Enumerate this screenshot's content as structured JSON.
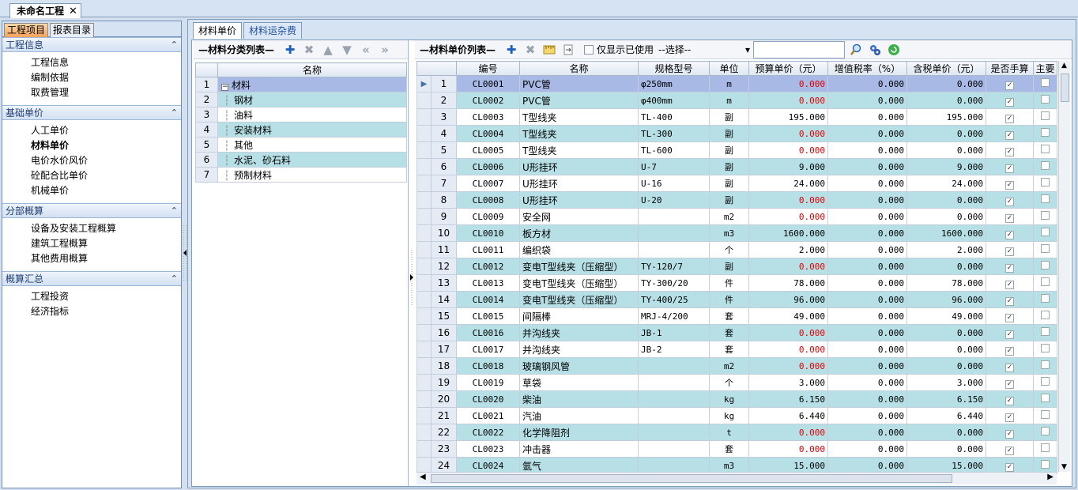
{
  "doc_tab": {
    "title": "未命名工程",
    "close": "✕"
  },
  "left_tabs": [
    {
      "label": "工程项目"
    },
    {
      "label": "报表目录"
    }
  ],
  "sections": [
    {
      "title": "工程信息",
      "items": [
        "工程信息",
        "编制依据",
        "取费管理"
      ]
    },
    {
      "title": "基础单价",
      "items": [
        "人工单价",
        "材料单价",
        "电价水价风价",
        "砼配合比单价",
        "机械单价"
      ]
    },
    {
      "title": "分部概算",
      "items": [
        "设备及安装工程概算",
        "建筑工程概算",
        "其他费用概算"
      ]
    },
    {
      "title": "概算汇总",
      "items": [
        "工程投资",
        "经济指标"
      ]
    }
  ],
  "active_nav": "材料单价",
  "main_tabs": [
    {
      "label": "材料单价"
    },
    {
      "label": "材料运杂费"
    }
  ],
  "category_pane": {
    "title": "—材料分类列表—",
    "column": "名称",
    "rows": [
      {
        "n": "1",
        "name": "材料"
      },
      {
        "n": "2",
        "name": "钢材"
      },
      {
        "n": "3",
        "name": "油料"
      },
      {
        "n": "4",
        "name": "安装材料"
      },
      {
        "n": "5",
        "name": "其他"
      },
      {
        "n": "6",
        "name": "水泥、砂石料"
      },
      {
        "n": "7",
        "name": "预制材料"
      }
    ]
  },
  "price_pane": {
    "title": "—材料单价列表—",
    "only_used_label": "仅显示已使用",
    "select_value": "--选择--",
    "columns": [
      "",
      "编号",
      "名称",
      "规格型号",
      "单位",
      "预算单价（元）",
      "增值税率（%）",
      "含税单价（元）",
      "是否手算",
      "主要"
    ],
    "rows": [
      {
        "n": "1",
        "code": "CL0001",
        "name": "PVC管",
        "spec": "φ250mm",
        "unit": "m",
        "price": "0.000",
        "tax": "0.000",
        "taxprice": "0.000"
      },
      {
        "n": "2",
        "code": "CL0002",
        "name": "PVC管",
        "spec": "φ400mm",
        "unit": "m",
        "price": "0.000",
        "tax": "0.000",
        "taxprice": "0.000"
      },
      {
        "n": "3",
        "code": "CL0003",
        "name": "T型线夹",
        "spec": "TL-400",
        "unit": "副",
        "price": "195.000",
        "tax": "0.000",
        "taxprice": "195.000"
      },
      {
        "n": "4",
        "code": "CL0004",
        "name": "T型线夹",
        "spec": "TL-300",
        "unit": "副",
        "price": "0.000",
        "tax": "0.000",
        "taxprice": "0.000"
      },
      {
        "n": "5",
        "code": "CL0005",
        "name": "T型线夹",
        "spec": "TL-600",
        "unit": "副",
        "price": "0.000",
        "tax": "0.000",
        "taxprice": "0.000"
      },
      {
        "n": "6",
        "code": "CL0006",
        "name": "U形挂环",
        "spec": "U-7",
        "unit": "副",
        "price": "9.000",
        "tax": "0.000",
        "taxprice": "9.000"
      },
      {
        "n": "7",
        "code": "CL0007",
        "name": "U形挂环",
        "spec": "U-16",
        "unit": "副",
        "price": "24.000",
        "tax": "0.000",
        "taxprice": "24.000"
      },
      {
        "n": "8",
        "code": "CL0008",
        "name": "U形挂环",
        "spec": "U-20",
        "unit": "副",
        "price": "0.000",
        "tax": "0.000",
        "taxprice": "0.000"
      },
      {
        "n": "9",
        "code": "CL0009",
        "name": "安全网",
        "spec": "",
        "unit": "m2",
        "price": "0.000",
        "tax": "0.000",
        "taxprice": "0.000"
      },
      {
        "n": "10",
        "code": "CL0010",
        "name": "板方材",
        "spec": "",
        "unit": "m3",
        "price": "1600.000",
        "tax": "0.000",
        "taxprice": "1600.000"
      },
      {
        "n": "11",
        "code": "CL0011",
        "name": "编织袋",
        "spec": "",
        "unit": "个",
        "price": "2.000",
        "tax": "0.000",
        "taxprice": "2.000"
      },
      {
        "n": "12",
        "code": "CL0012",
        "name": "变电T型线夹（压缩型）",
        "spec": "TY-120/7",
        "unit": "副",
        "price": "0.000",
        "tax": "0.000",
        "taxprice": "0.000"
      },
      {
        "n": "13",
        "code": "CL0013",
        "name": "变电T型线夹（压缩型）",
        "spec": "TY-300/20",
        "unit": "件",
        "price": "78.000",
        "tax": "0.000",
        "taxprice": "78.000"
      },
      {
        "n": "14",
        "code": "CL0014",
        "name": "变电T型线夹（压缩型）",
        "spec": "TY-400/25",
        "unit": "件",
        "price": "96.000",
        "tax": "0.000",
        "taxprice": "96.000"
      },
      {
        "n": "15",
        "code": "CL0015",
        "name": "间隔棒",
        "spec": "MRJ-4/200",
        "unit": "套",
        "price": "49.000",
        "tax": "0.000",
        "taxprice": "49.000"
      },
      {
        "n": "16",
        "code": "CL0016",
        "name": "并沟线夹",
        "spec": "JB-1",
        "unit": "套",
        "price": "0.000",
        "tax": "0.000",
        "taxprice": "0.000"
      },
      {
        "n": "17",
        "code": "CL0017",
        "name": "并沟线夹",
        "spec": "JB-2",
        "unit": "套",
        "price": "0.000",
        "tax": "0.000",
        "taxprice": "0.000"
      },
      {
        "n": "18",
        "code": "CL0018",
        "name": "玻璃钢风管",
        "spec": "",
        "unit": "m2",
        "price": "0.000",
        "tax": "0.000",
        "taxprice": "0.000"
      },
      {
        "n": "19",
        "code": "CL0019",
        "name": "草袋",
        "spec": "",
        "unit": "个",
        "price": "3.000",
        "tax": "0.000",
        "taxprice": "3.000"
      },
      {
        "n": "20",
        "code": "CL0020",
        "name": "柴油",
        "spec": "",
        "unit": "kg",
        "price": "6.150",
        "tax": "0.000",
        "taxprice": "6.150"
      },
      {
        "n": "21",
        "code": "CL0021",
        "name": "汽油",
        "spec": "",
        "unit": "kg",
        "price": "6.440",
        "tax": "0.000",
        "taxprice": "6.440"
      },
      {
        "n": "22",
        "code": "CL0022",
        "name": "化学降阻剂",
        "spec": "",
        "unit": "t",
        "price": "0.000",
        "tax": "0.000",
        "taxprice": "0.000"
      },
      {
        "n": "23",
        "code": "CL0023",
        "name": "冲击器",
        "spec": "",
        "unit": "套",
        "price": "0.000",
        "tax": "0.000",
        "taxprice": "0.000"
      },
      {
        "n": "24",
        "code": "CL0024",
        "name": "氩气",
        "spec": "",
        "unit": "m3",
        "price": "15.000",
        "tax": "0.000",
        "taxprice": "15.000"
      }
    ]
  },
  "colors": {
    "accent": "#1f5fbf",
    "zero_price": "#e00000",
    "row_teal": "#b7e0e6",
    "row_selected": "#a8b9e6"
  }
}
